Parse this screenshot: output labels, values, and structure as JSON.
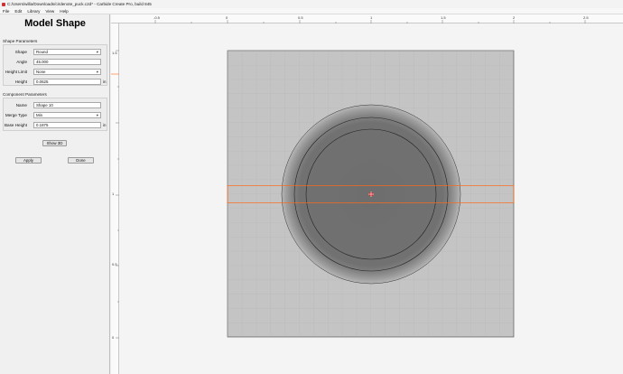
{
  "window": {
    "title": "C:/Users/willa/Downloads/cirdenote_puck.c2d* - Carbide Create Pro, build 845"
  },
  "menu": [
    "File",
    "Edit",
    "Library",
    "View",
    "Help"
  ],
  "panel": {
    "title": "Model Shape",
    "shape_params": {
      "label": "Shape Parameters",
      "shape": {
        "label": "Shape",
        "value": "Round"
      },
      "angle": {
        "label": "Angle",
        "value": "45.000"
      },
      "height_limit": {
        "label": "Height Limit",
        "value": "None"
      },
      "height": {
        "label": "Height",
        "value": "0.0625",
        "unit": "in"
      }
    },
    "component_params": {
      "label": "Component Parameters",
      "name": {
        "label": "Name",
        "value": "Shape 10"
      },
      "merge_type": {
        "label": "Merge Type",
        "value": "Min"
      },
      "base_height": {
        "label": "Base Height",
        "value": "0.1875",
        "unit": "in"
      }
    },
    "show3d_label": "Show 3D",
    "apply_label": "Apply",
    "done_label": "Done"
  },
  "rulers": {
    "top": [
      "-0.5",
      "0",
      "0.5",
      "1",
      "1.5",
      "2",
      "2.5"
    ],
    "left": [
      "1.5",
      "1",
      "0.5",
      "0"
    ]
  },
  "colors": {
    "selection": "#ff6a1a",
    "origin_marker": "#e01b1b",
    "stock": "#c4c4c4",
    "grid": "#afafaf"
  }
}
